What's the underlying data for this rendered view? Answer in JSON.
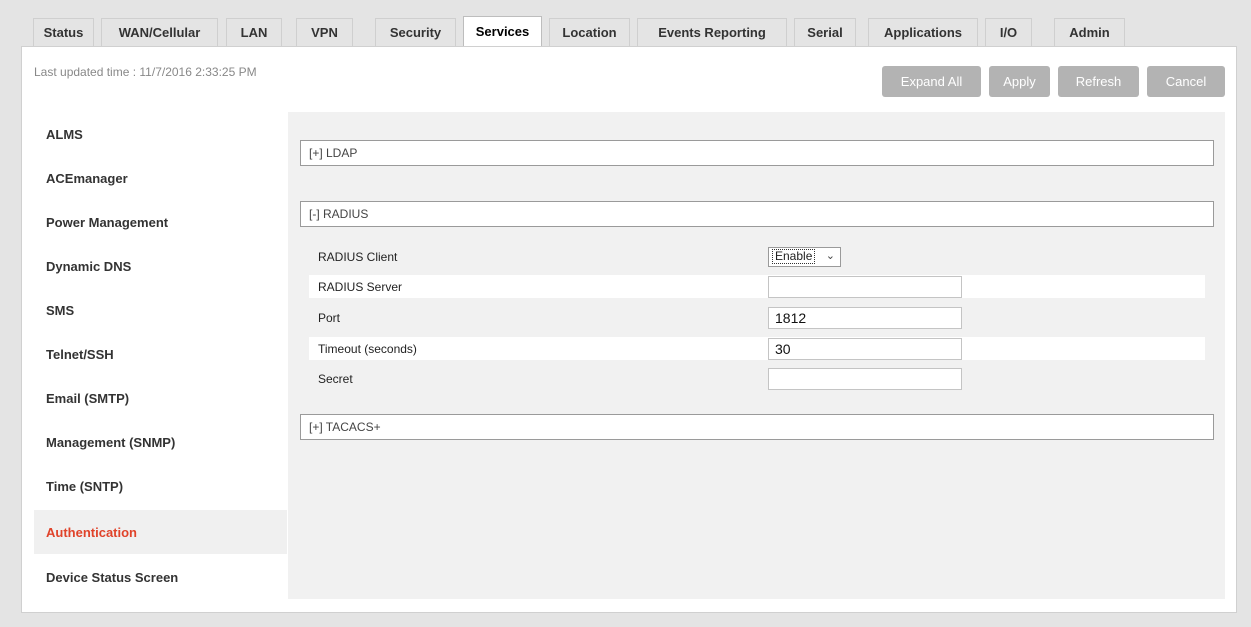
{
  "tabs": [
    {
      "label": "Status",
      "active": false
    },
    {
      "label": "WAN/Cellular",
      "active": false
    },
    {
      "label": "LAN",
      "active": false
    },
    {
      "label": "VPN",
      "active": false
    },
    {
      "label": "Security",
      "active": false
    },
    {
      "label": "Services",
      "active": true
    },
    {
      "label": "Location",
      "active": false
    },
    {
      "label": "Events Reporting",
      "active": false
    },
    {
      "label": "Serial",
      "active": false
    },
    {
      "label": "Applications",
      "active": false
    },
    {
      "label": "I/O",
      "active": false
    },
    {
      "label": "Admin",
      "active": false
    }
  ],
  "header": {
    "last_updated": "Last updated time : 11/7/2016 2:33:25 PM"
  },
  "toolbar": {
    "expand_all": "Expand All",
    "apply": "Apply",
    "refresh": "Refresh",
    "cancel": "Cancel"
  },
  "sidebar": {
    "items": [
      {
        "label": "ALMS"
      },
      {
        "label": "ACEmanager"
      },
      {
        "label": "Power Management"
      },
      {
        "label": "Dynamic DNS"
      },
      {
        "label": "SMS"
      },
      {
        "label": "Telnet/SSH"
      },
      {
        "label": "Email (SMTP)"
      },
      {
        "label": "Management (SNMP)"
      },
      {
        "label": "Time (SNTP)"
      },
      {
        "label": "Authentication",
        "active": true
      },
      {
        "label": "Device Status Screen"
      }
    ]
  },
  "sections": {
    "ldap": "[+] LDAP",
    "radius": "[-] RADIUS",
    "tacacs": "[+] TACACS+"
  },
  "radius": {
    "client_label": "RADIUS Client",
    "client_value": "Enable",
    "server_label": "RADIUS Server",
    "server_value": "",
    "port_label": "Port",
    "port_value": "1812",
    "timeout_label": "Timeout (seconds)",
    "timeout_value": "30",
    "secret_label": "Secret",
    "secret_value": ""
  },
  "colors": {
    "active_sidebar_text": "#e0432a",
    "button_bg": "#b3b3b3"
  }
}
